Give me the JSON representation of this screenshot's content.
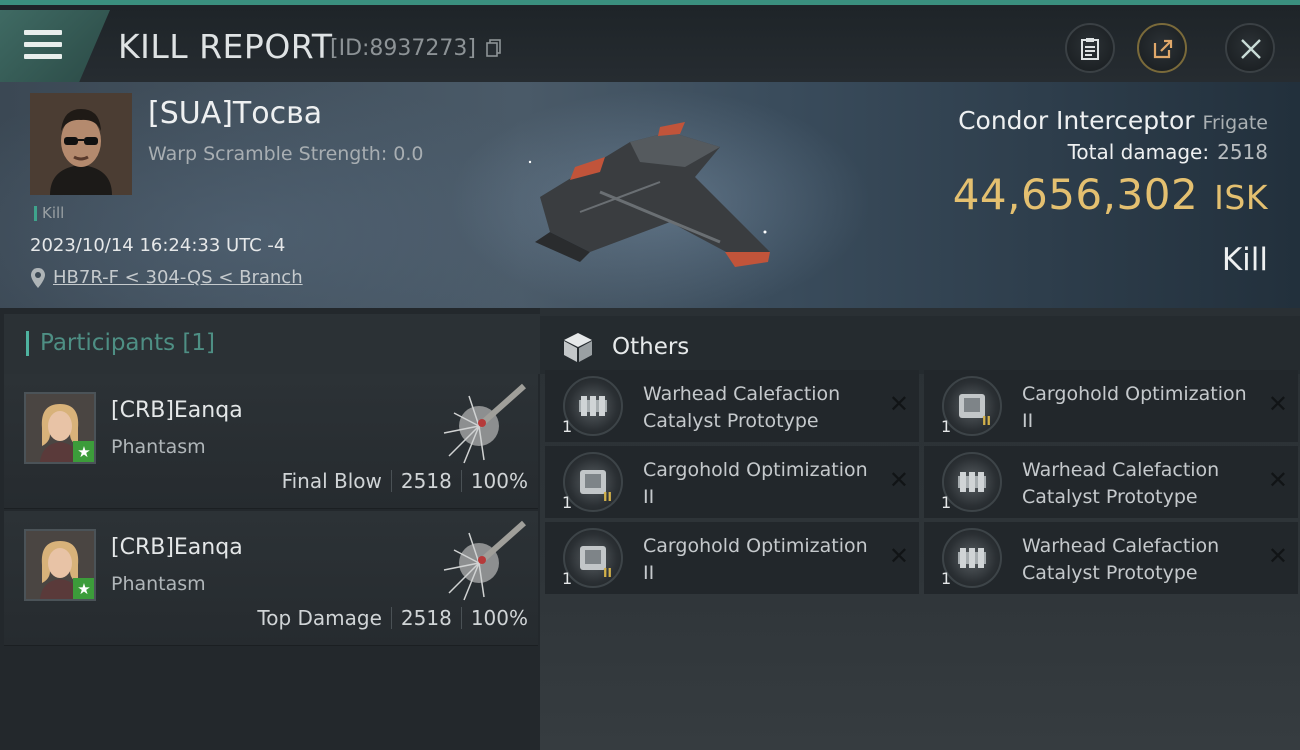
{
  "header": {
    "title": "KILL REPORT",
    "kill_id": "[ID:8937273]",
    "menu_icon": "hamburger-menu-icon",
    "buttons": [
      {
        "name": "clipboard-icon"
      },
      {
        "name": "share-icon"
      },
      {
        "name": "close-icon"
      }
    ]
  },
  "victim": {
    "name": "[SUA]Тосва",
    "warp_scramble": "Warp Scramble Strength: 0.0",
    "tag": "Kill",
    "datetime": "2023/10/14 16:24:33 UTC -4",
    "location": "HB7R-F < 304-QS < Branch",
    "ship_name": "Condor Interceptor",
    "ship_class": "Frigate",
    "total_damage_label": "Total damage:",
    "total_damage": "2518",
    "isk_value": "44,656,302",
    "isk_unit": "ISK",
    "result": "Kill"
  },
  "participants": {
    "header": "Participants",
    "count": "[1]",
    "list": [
      {
        "name": "[CRB]Eanqa",
        "ship": "Phantasm",
        "role": "Final Blow",
        "damage": "2518",
        "percent": "100%"
      },
      {
        "name": "[CRB]Eanqa",
        "ship": "Phantasm",
        "role": "Top Damage",
        "damage": "2518",
        "percent": "100%"
      }
    ]
  },
  "others": {
    "header": "Others",
    "items": [
      {
        "name": "Warhead Calefaction Catalyst Prototype",
        "qty": "1",
        "tier": ""
      },
      {
        "name": "Cargohold Optimization II",
        "qty": "1",
        "tier": "II"
      },
      {
        "name": "Cargohold Optimization II",
        "qty": "1",
        "tier": "II"
      },
      {
        "name": "Warhead Calefaction Catalyst Prototype",
        "qty": "1",
        "tier": ""
      },
      {
        "name": "Cargohold Optimization II",
        "qty": "1",
        "tier": "II"
      },
      {
        "name": "Warhead Calefaction Catalyst Prototype",
        "qty": "1",
        "tier": ""
      }
    ]
  },
  "colors": {
    "accent": "#3fa38c",
    "isk": "#e4c070"
  }
}
